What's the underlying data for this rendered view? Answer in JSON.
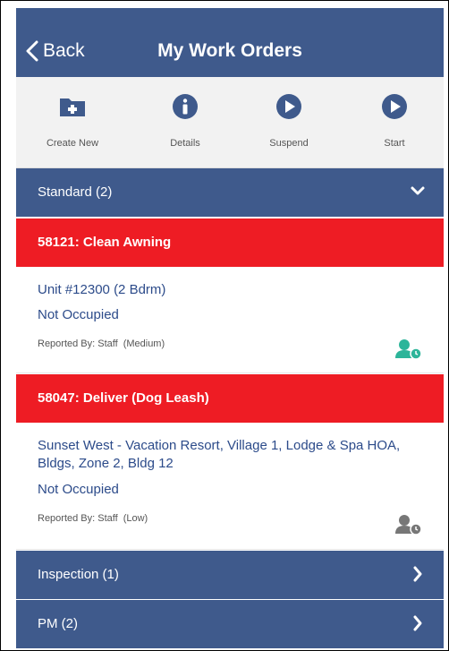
{
  "navbar": {
    "back_label": "Back",
    "title": "My Work Orders"
  },
  "toolbar": {
    "create_label": "Create New",
    "details_label": "Details",
    "suspend_label": "Suspend",
    "start_label": "Start"
  },
  "sections": {
    "standard": "Standard (2)",
    "inspection": "Inspection (1)",
    "pm": "PM (2)"
  },
  "orders": [
    {
      "title": "58121: Clean Awning",
      "location": "Unit #12300 (2 Bdrm)",
      "occupancy": "Not Occupied",
      "reported": "Reported By: Staff",
      "priority": "(Medium)",
      "assignee_color": "#2db59a"
    },
    {
      "title": "58047: Deliver (Dog Leash)",
      "location": "Sunset West - Vacation Resort, Village 1, Lodge & Spa HOA, Bldgs, Zone 2, Bldg 12",
      "occupancy": "Not Occupied",
      "reported": "Reported By: Staff",
      "priority": "(Low)",
      "assignee_color": "#777777"
    }
  ],
  "colors": {
    "nav": "#3f5a8c",
    "alert": "#ee1c24",
    "link": "#2c4b8a"
  }
}
